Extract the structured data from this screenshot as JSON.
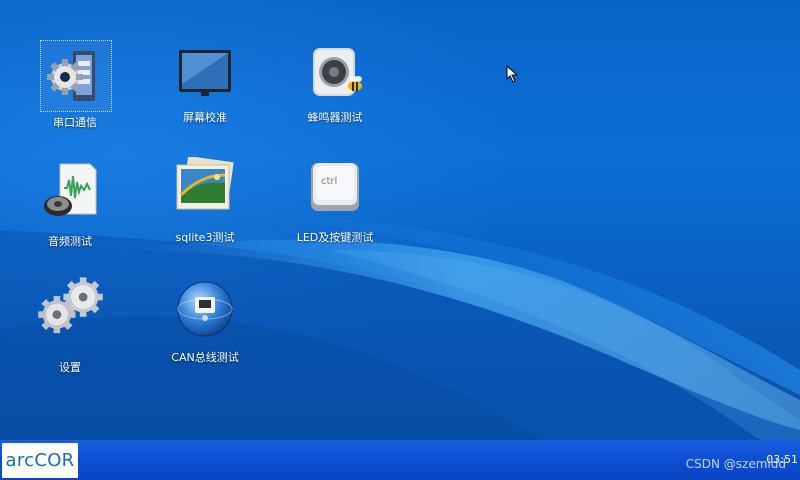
{
  "desktop": {
    "icons": [
      {
        "label": "串口通信",
        "icon": "serial-port-gear-icon"
      },
      {
        "label": "屏幕校准",
        "icon": "monitor-icon"
      },
      {
        "label": "蜂鸣器测试",
        "icon": "speaker-bee-icon"
      },
      {
        "label": "音频测试",
        "icon": "audio-document-speaker-icon"
      },
      {
        "label": "sqlite3测试",
        "icon": "photo-picture-icon"
      },
      {
        "label": "LED及按键测试",
        "icon": "ctrl-key-icon"
      },
      {
        "label": "设置",
        "icon": "gears-settings-icon"
      },
      {
        "label": "CAN总线测试",
        "icon": "network-globe-icon"
      }
    ]
  },
  "taskbar": {
    "start_logo": "arcCOR",
    "clock": "03:51",
    "watermark": "CSDN @szemidd"
  },
  "colors": {
    "desktop_blue": "#0b6fd6",
    "taskbar_blue": "#0d4fd3",
    "logo_blue": "#1a6bb8"
  }
}
